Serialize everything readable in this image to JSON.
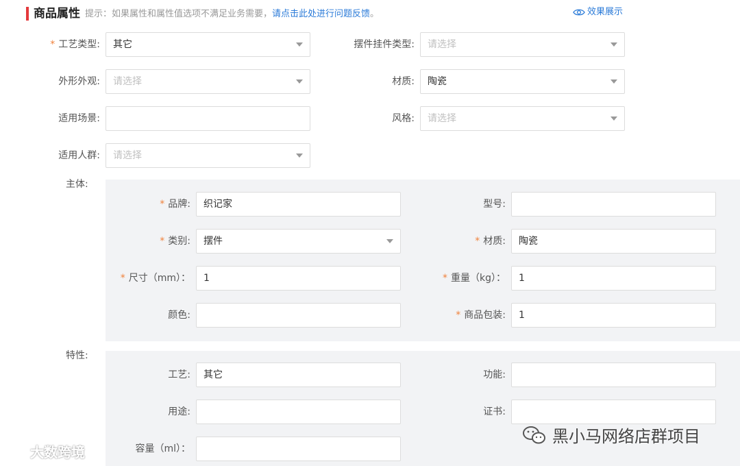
{
  "header": {
    "title": "商品属性",
    "tip_prefix": "提示：如果属性和属性值选项不满足业务需要，",
    "tip_link": "请点击此处进行问题反馈",
    "tip_suffix": "。",
    "preview_label": "效果展示"
  },
  "top_fields": {
    "craft_type": {
      "label": "工艺类型:",
      "value": "其它"
    },
    "ornament_type": {
      "label": "摆件挂件类型:",
      "placeholder": "请选择"
    },
    "appearance": {
      "label": "外形外观:",
      "placeholder": "请选择"
    },
    "material": {
      "label": "材质:",
      "value": "陶瓷"
    },
    "scene": {
      "label": "适用场景:",
      "value": ""
    },
    "style": {
      "label": "风格:",
      "placeholder": "请选择"
    },
    "audience": {
      "label": "适用人群:",
      "placeholder": "请选择"
    }
  },
  "main_section": {
    "label": "主体:",
    "brand": {
      "label": "品牌:",
      "value": "织记家"
    },
    "model": {
      "label": "型号:",
      "value": ""
    },
    "category": {
      "label": "类别:",
      "value": "摆件"
    },
    "material": {
      "label": "材质:",
      "value": "陶瓷"
    },
    "size": {
      "label": "尺寸（mm）：",
      "value": "1"
    },
    "weight": {
      "label": "重量（kg）：",
      "value": "1"
    },
    "color": {
      "label": "颜色:",
      "value": ""
    },
    "packaging": {
      "label": "商品包装:",
      "value": "1"
    }
  },
  "feature_section": {
    "label": "特性:",
    "craft": {
      "label": "工艺:",
      "value": "其它"
    },
    "function": {
      "label": "功能:",
      "value": ""
    },
    "usage": {
      "label": "用途:",
      "value": ""
    },
    "certificate": {
      "label": "证书:",
      "value": ""
    },
    "capacity": {
      "label": "容量（ml）：",
      "value": ""
    }
  },
  "watermarks": {
    "left": "大数跨境",
    "right": "黑小马网络店群项目"
  },
  "colors": {
    "accent_red": "#e4393c",
    "required_star": "#f0823c",
    "link_blue": "#2b7bd8",
    "panel_bg": "#f2f3f5"
  },
  "icons": [
    "eye-icon",
    "dropdown-arrow-icon",
    "weibo-icon",
    "wechat-icon"
  ]
}
